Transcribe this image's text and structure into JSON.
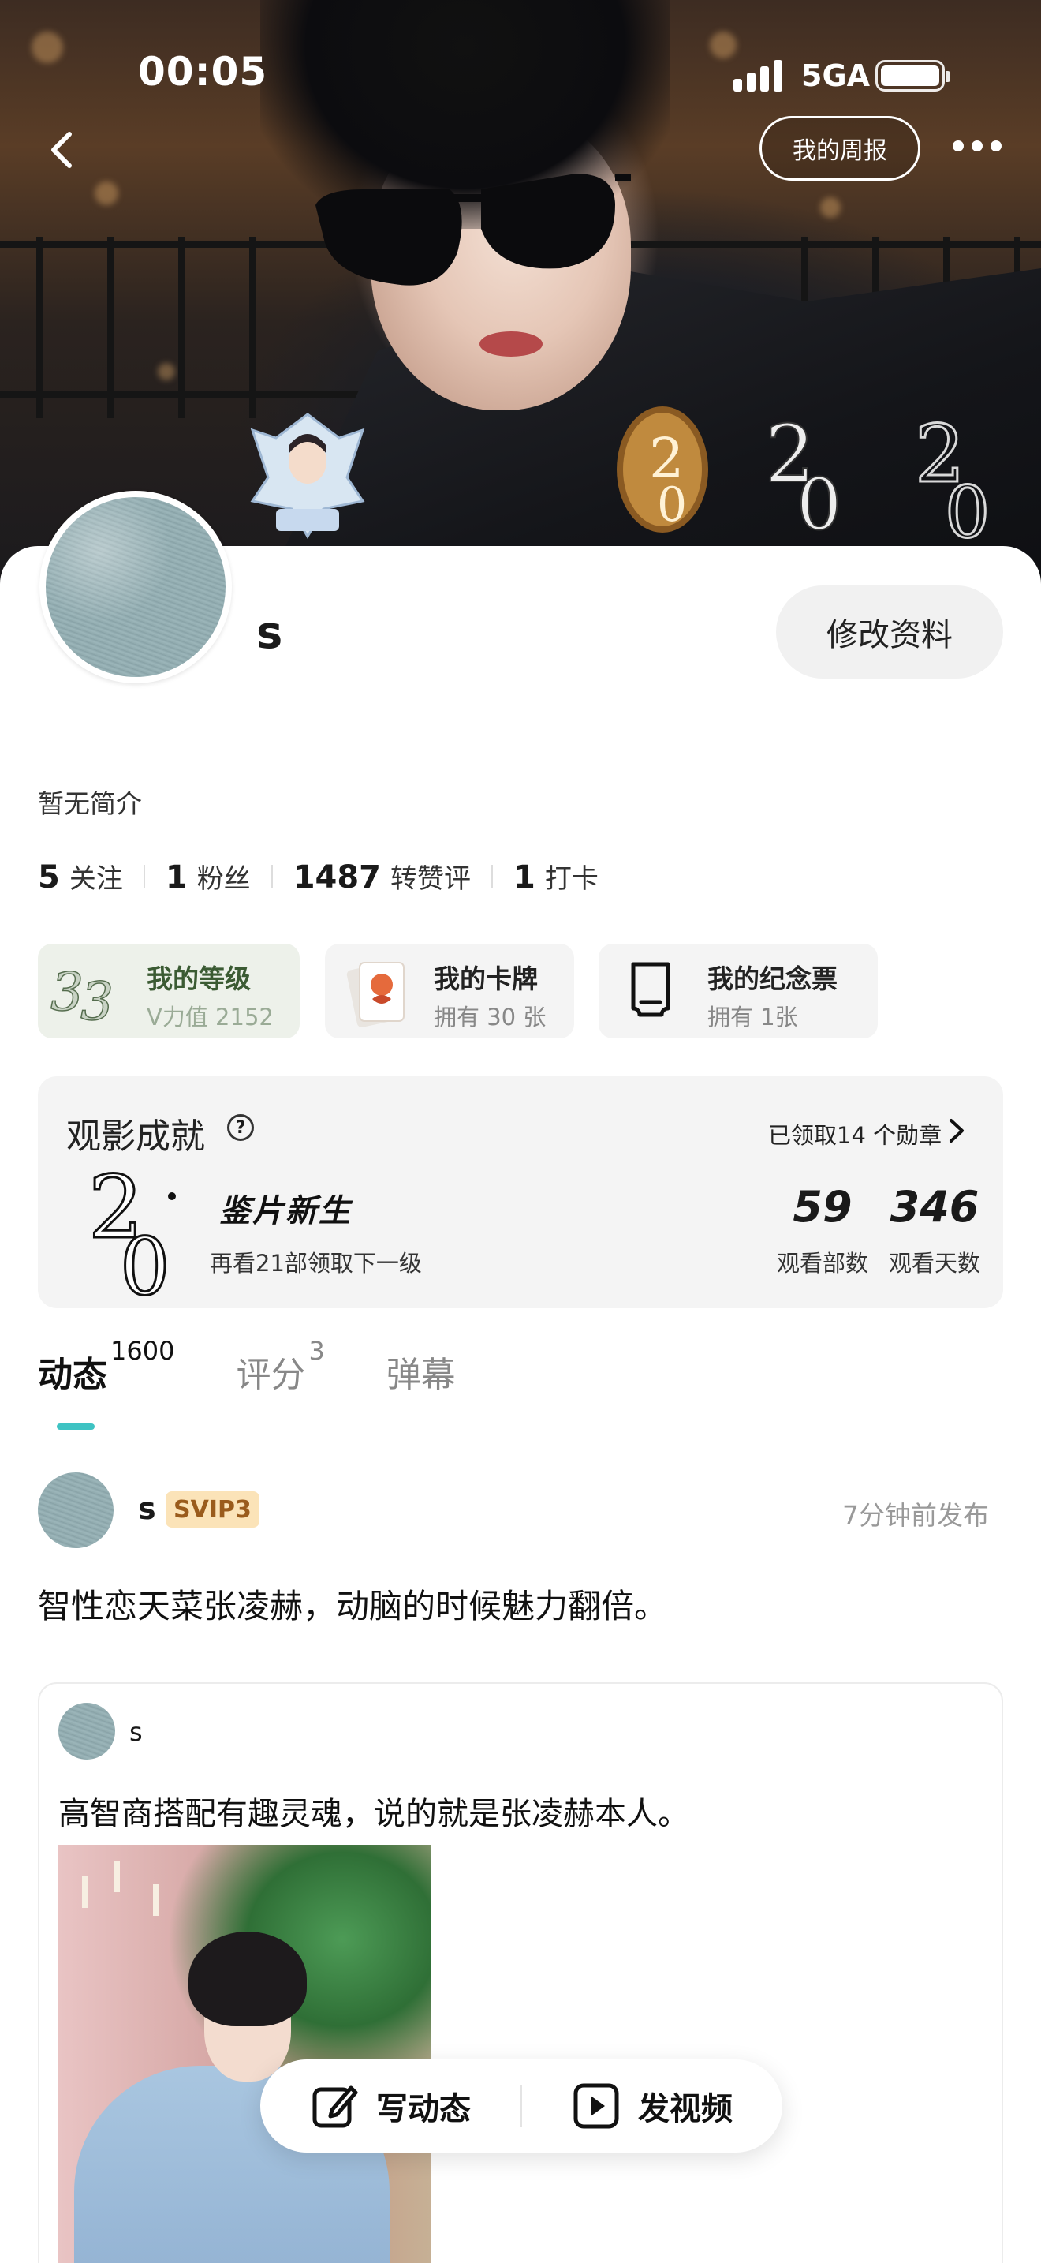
{
  "status_bar": {
    "time": "00:05",
    "network": "5GA"
  },
  "nav": {
    "weekly_report_label": "我的周报"
  },
  "profile": {
    "username": "s",
    "edit_label": "修改资料",
    "bio": "暂无简介"
  },
  "stats": [
    {
      "value": "5",
      "label": "关注"
    },
    {
      "value": "1",
      "label": "粉丝"
    },
    {
      "value": "1487",
      "label": "转赞评"
    },
    {
      "value": "1",
      "label": "打卡"
    }
  ],
  "pills": {
    "level": {
      "title": "我的等级",
      "sub": "V力值 2152"
    },
    "cards": {
      "title": "我的卡牌",
      "sub": "拥有 30 张"
    },
    "tickets": {
      "title": "我的纪念票",
      "sub": "拥有 1张"
    }
  },
  "achievements": {
    "title": "观影成就",
    "claimed": "已领取14 个勋章",
    "level_name": "鉴片新生",
    "hint": "再看21部领取下一级",
    "watched_count": "59",
    "watched_count_label": "观看部数",
    "watched_days": "346",
    "watched_days_label": "观看天数"
  },
  "tabs": [
    {
      "label": "动态",
      "count": "1600",
      "active": true
    },
    {
      "label": "评分",
      "count": "3",
      "active": false
    },
    {
      "label": "弹幕",
      "count": "",
      "active": false
    }
  ],
  "post": {
    "user": "s",
    "badge": "SVIP3",
    "time": "7分钟前发布",
    "text": "智性恋天菜张凌赫，动脑的时候魅力翻倍。",
    "repost": {
      "user": "s",
      "text": "高智商搭配有趣灵魂，说的就是张凌赫本人。"
    }
  },
  "fab": {
    "write_label": "写动态",
    "video_label": "发视频"
  },
  "colors": {
    "accent": "#3ec3c3",
    "svip_bg": "#fbe3b8",
    "svip_text": "#9a5b1c"
  },
  "icons": [
    "back-icon",
    "more-icon",
    "help-icon",
    "chevron-right-icon",
    "edit-icon",
    "video-icon",
    "ticket-icon"
  ]
}
